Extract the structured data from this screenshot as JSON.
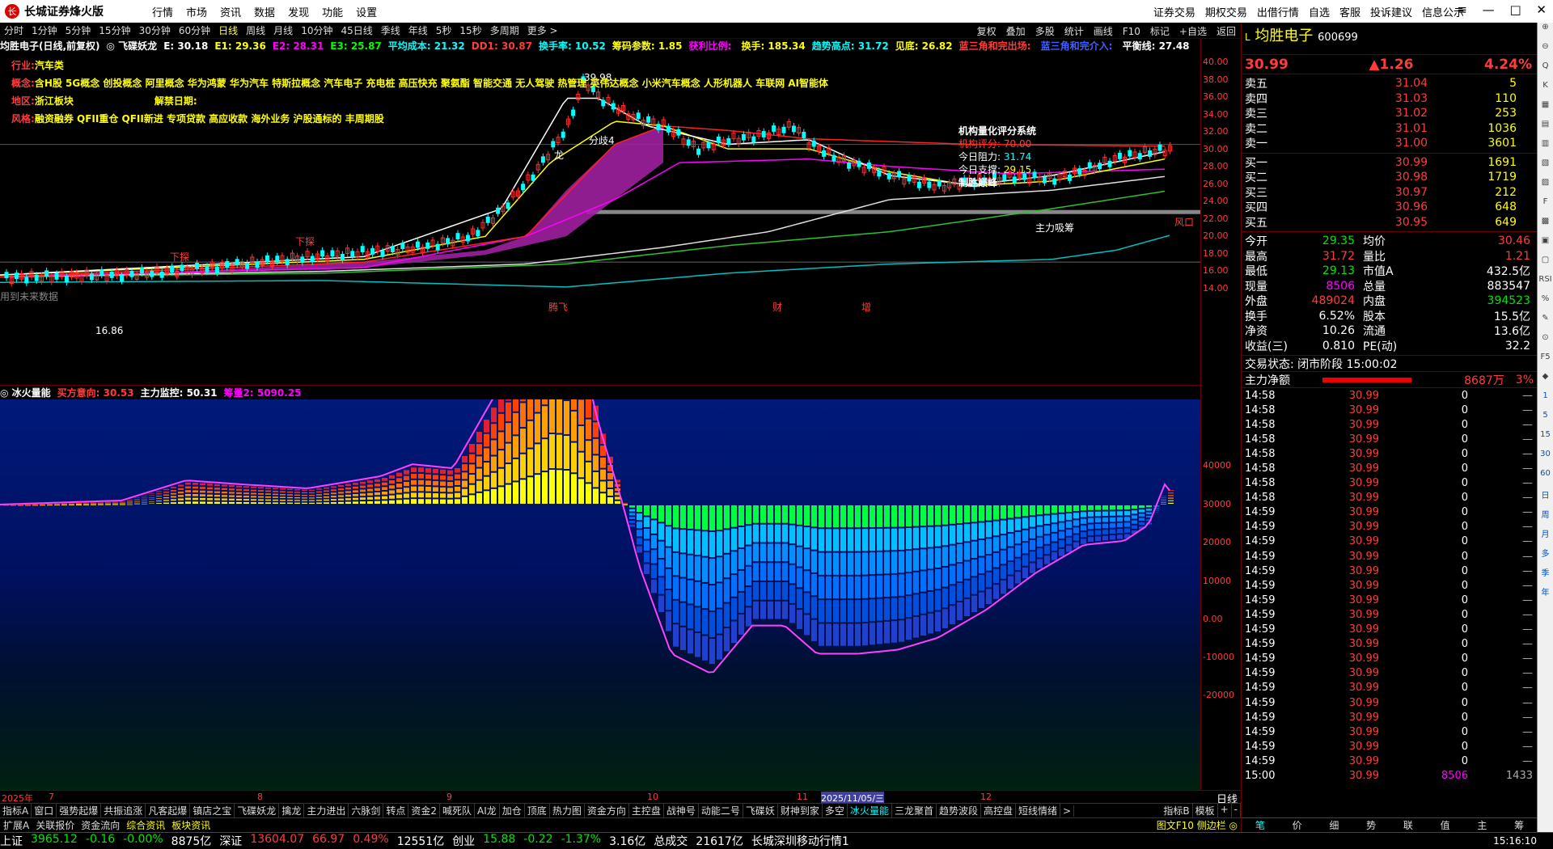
{
  "app": {
    "title": "长城证券烽火版",
    "menus": [
      "行情",
      "市场",
      "资讯",
      "数据",
      "发现",
      "功能",
      "设置"
    ],
    "right_menus": [
      "证券交易",
      "期权交易",
      "出借行情",
      "自选",
      "客服",
      "投诉建议",
      "信息公示"
    ]
  },
  "periods": [
    "分时",
    "1分钟",
    "5分钟",
    "15分钟",
    "30分钟",
    "60分钟",
    "日线",
    "周线",
    "月线",
    "10分钟",
    "45日线",
    "季线",
    "年线",
    "5秒",
    "15秒",
    "多周期",
    "更多 >"
  ],
  "active_period": "日线",
  "chart_tools": [
    "复权",
    "叠加",
    "多股",
    "统计",
    "画线",
    "F10",
    "标记",
    "+自选",
    "返回"
  ],
  "indicator_line": [
    {
      "t": "均胜电子(日线,前复权)",
      "c": "#ffffff"
    },
    {
      "t": "◎ 飞碟妖龙",
      "c": "#ffffff"
    },
    {
      "t": "E: 30.18",
      "c": "#ffffff"
    },
    {
      "t": "E1: 29.36",
      "c": "#ffff00"
    },
    {
      "t": "E2: 28.31",
      "c": "#ff00ff"
    },
    {
      "t": "E3: 25.87",
      "c": "#00ff00"
    },
    {
      "t": "平均成本: 21.32",
      "c": "#00ffff"
    },
    {
      "t": "DD1: 30.87",
      "c": "#ff3c3c"
    },
    {
      "t": "换手率: 10.52",
      "c": "#00ffff"
    },
    {
      "t": "筹码参数: 1.85",
      "c": "#ffff00"
    },
    {
      "t": "获利比例: ",
      "c": "#ff00ff"
    },
    {
      "t": "换手: 185.34",
      "c": "#ffff00"
    },
    {
      "t": "趋势高点: 31.72",
      "c": "#00ffff"
    },
    {
      "t": "见底: 26.82",
      "c": "#ffff00"
    },
    {
      "t": "蓝三角和完出场: ",
      "c": "#ff3c3c"
    },
    {
      "t": "蓝三角和完介入: ",
      "c": "#4060ff"
    },
    {
      "t": "平衡线: 27.48",
      "c": "#ffffff"
    }
  ],
  "info_lines": [
    {
      "label": "行业:",
      "text": "汽车类"
    },
    {
      "label": "概念:",
      "text": "含H股 5G概念 创投概念 阿里概念 华为鸿蒙 华为汽车 特斯拉概念 汽车电子 充电桩 高压快充 聚氨酯 智能交通 无人驾驶 热管理 英伟达概念 小米汽车概念 人形机器人 车联网 AI智能体"
    },
    {
      "label": "地区:",
      "text": "浙江板块",
      "extra": "解禁日期:"
    },
    {
      "label": "风格:",
      "text": "融资融券 QFII重仓 QFII新进 专项贷款 高应收款 海外业务 沪股通标的 丰周期股"
    }
  ],
  "score_box": {
    "title": "机构量化评分系统",
    "lines": [
      {
        "k": "机构评分:",
        "v": "70.00"
      },
      {
        "k": "今日阻力:",
        "v": "31.74"
      },
      {
        "k": "今日支撑:",
        "v": "29.15"
      }
    ],
    "verdict": "制胜巅峰"
  },
  "main_annotations": [
    "39.98",
    "16.86",
    "龙",
    "分歧4",
    "下探",
    "下探",
    "主力吸筹",
    "风口",
    "腾飞",
    "财",
    "增",
    "用到未来数据"
  ],
  "main_axis": [
    "40.00",
    "38.00",
    "36.00",
    "34.00",
    "32.00",
    "30.00",
    "28.00",
    "26.00",
    "24.00",
    "22.00",
    "20.00",
    "18.00",
    "16.00",
    "14.00"
  ],
  "sub_header": [
    {
      "t": "◎ 冰火量能",
      "c": "#ffffff"
    },
    {
      "t": "买方意向: 30.53",
      "c": "#ff3c3c"
    },
    {
      "t": "主力监控: 50.31",
      "c": "#ffffff"
    },
    {
      "t": "筹量2: 5090.25",
      "c": "#ff00ff"
    }
  ],
  "sub_axis": [
    "40000",
    "30000",
    "20000",
    "10000",
    "0.00",
    "-10000",
    "-20000"
  ],
  "dates": [
    "2025年",
    "7",
    "8",
    "9",
    "10",
    "11",
    "2025/11/05/三",
    "12"
  ],
  "tabs": [
    "指标A",
    "窗口",
    "强势起爆",
    "共振追涨",
    "凡客起爆",
    "镇店之宝",
    "飞碟妖龙",
    "擒龙",
    "主力进出",
    "六脉剑",
    "转点",
    "资金2",
    "喊死队",
    "AI龙",
    "加仓",
    "顶底",
    "热力图",
    "资金方向",
    "主控盘",
    "战神号",
    "动能二号",
    "飞碟妖",
    "财神到家",
    "多空",
    "冰火量能",
    "三龙聚首",
    "趋势波段",
    "高控盘",
    "短线情绪",
    ">"
  ],
  "active_tab": "冰火量能",
  "tabs_right": [
    "指标B",
    "模板",
    "+",
    "-"
  ],
  "tabs2": [
    "扩展A",
    "关联报价",
    "资金流向",
    "综合资讯",
    "板块资讯"
  ],
  "tabs2_right": "图文F10 侧边栏 ◎",
  "quote": {
    "name": "均胜电子",
    "code": "600699",
    "price": "30.99",
    "change": "▲1.26",
    "pct": "4.24%",
    "asks": [
      [
        "卖五",
        "31.04",
        "5"
      ],
      [
        "卖四",
        "31.03",
        "110"
      ],
      [
        "卖三",
        "31.02",
        "253"
      ],
      [
        "卖二",
        "31.01",
        "1036"
      ],
      [
        "卖一",
        "31.00",
        "3601"
      ]
    ],
    "bids": [
      [
        "买一",
        "30.99",
        "1691"
      ],
      [
        "买二",
        "30.98",
        "1719"
      ],
      [
        "买三",
        "30.97",
        "212"
      ],
      [
        "买四",
        "30.96",
        "648"
      ],
      [
        "买五",
        "30.95",
        "649"
      ]
    ],
    "stats": [
      [
        "今开",
        "29.35",
        "均价",
        "30.46"
      ],
      [
        "最高",
        "31.72",
        "量比",
        "1.21"
      ],
      [
        "最低",
        "29.13",
        "市值A",
        "432.5亿"
      ],
      [
        "现量",
        "8506",
        "总量",
        "883547"
      ],
      [
        "外盘",
        "489024",
        "内盘",
        "394523"
      ],
      [
        "换手",
        "6.52%",
        "股本",
        "15.5亿"
      ],
      [
        "净资",
        "10.26",
        "流通",
        "13.6亿"
      ],
      [
        "收益(三)",
        "0.810",
        "PE(动)",
        "32.2"
      ]
    ],
    "status": "交易状态: 闭市阶段 15:00:02",
    "netflow": {
      "label": "主力净额",
      "value": "8687万",
      "pct": "3%"
    },
    "ticks": [
      [
        "14:58",
        "30.99",
        "0"
      ],
      [
        "14:58",
        "30.99",
        "0"
      ],
      [
        "14:58",
        "30.99",
        "0"
      ],
      [
        "14:58",
        "30.99",
        "0"
      ],
      [
        "14:58",
        "30.99",
        "0"
      ],
      [
        "14:58",
        "30.99",
        "0"
      ],
      [
        "14:58",
        "30.99",
        "0"
      ],
      [
        "14:58",
        "30.99",
        "0"
      ],
      [
        "14:59",
        "30.99",
        "0"
      ],
      [
        "14:59",
        "30.99",
        "0"
      ],
      [
        "14:59",
        "30.99",
        "0"
      ],
      [
        "14:59",
        "30.99",
        "0"
      ],
      [
        "14:59",
        "30.99",
        "0"
      ],
      [
        "14:59",
        "30.99",
        "0"
      ],
      [
        "14:59",
        "30.99",
        "0"
      ],
      [
        "14:59",
        "30.99",
        "0"
      ],
      [
        "14:59",
        "30.99",
        "0"
      ],
      [
        "14:59",
        "30.99",
        "0"
      ],
      [
        "14:59",
        "30.99",
        "0"
      ],
      [
        "14:59",
        "30.99",
        "0"
      ],
      [
        "14:59",
        "30.99",
        "0"
      ],
      [
        "14:59",
        "30.99",
        "0"
      ],
      [
        "14:59",
        "30.99",
        "0"
      ],
      [
        "14:59",
        "30.99",
        "0"
      ],
      [
        "14:59",
        "30.99",
        "0"
      ],
      [
        "14:59",
        "30.99",
        "0"
      ],
      [
        "15:00",
        "30.99",
        "8506",
        "1433"
      ]
    ],
    "tabs": [
      "笔",
      "价",
      "细",
      "势",
      "联",
      "值",
      "主",
      "筹"
    ]
  },
  "rtools": [
    "⊕",
    "⊖",
    "Q",
    "K",
    "▦",
    "▤",
    "▥",
    "▧",
    "▨",
    "F",
    "▩",
    "▣",
    "▢",
    "RSI",
    "%",
    "✎",
    "⊙",
    "F5",
    "◆",
    "1",
    "5",
    "15",
    "30",
    "60",
    "日",
    "周",
    "月",
    "多",
    "季",
    "年"
  ],
  "statusbar": [
    {
      "t": "上证",
      "c": "#fff"
    },
    {
      "t": "3965.12",
      "c": "#00e600"
    },
    {
      "t": "-0.16",
      "c": "#00e600"
    },
    {
      "t": "-0.00%",
      "c": "#00e600"
    },
    {
      "t": "8875亿",
      "c": "#fff"
    },
    {
      "t": "深证",
      "c": "#fff"
    },
    {
      "t": "13604.07",
      "c": "#ff3c3c"
    },
    {
      "t": "66.97",
      "c": "#ff3c3c"
    },
    {
      "t": "0.49%",
      "c": "#ff3c3c"
    },
    {
      "t": "12551亿",
      "c": "#fff"
    },
    {
      "t": "创业",
      "c": "#fff"
    },
    {
      "t": "15.88",
      "c": "#00e600"
    },
    {
      "t": "-0.22",
      "c": "#00e600"
    },
    {
      "t": "-1.37%",
      "c": "#00e600"
    },
    {
      "t": "3.16亿",
      "c": "#fff"
    },
    {
      "t": "总成交",
      "c": "#fff"
    },
    {
      "t": "21617亿",
      "c": "#fff"
    },
    {
      "t": "长城深圳移动行情1",
      "c": "#fff"
    }
  ],
  "clock": "15:16:10"
}
